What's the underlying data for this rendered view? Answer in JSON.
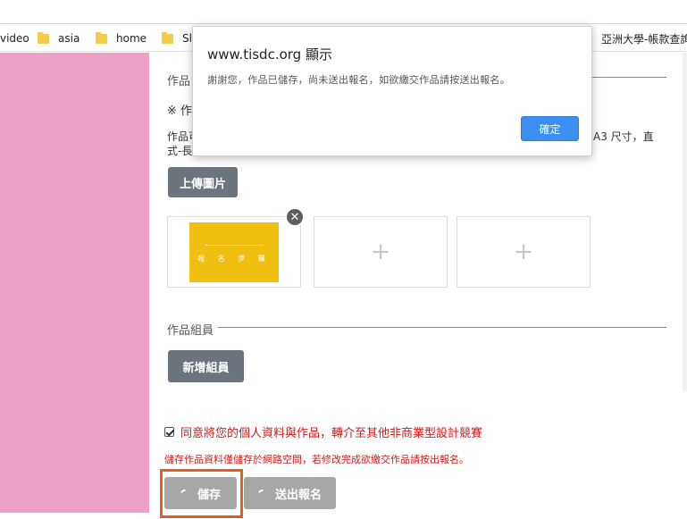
{
  "bookmarks": [
    {
      "label": "video",
      "folder": false
    },
    {
      "label": "asia",
      "folder": true
    },
    {
      "label": "home",
      "folder": true
    },
    {
      "label": "Sl",
      "folder": true
    },
    {
      "label": "亞洲大學-帳款查詢",
      "folder": false
    }
  ],
  "form": {
    "section_works_label": "作品",
    "note_prefix": "※ 作",
    "desc_line1_start": "作品可",
    "desc_line1_end": "A3 尺寸，直",
    "desc_line2_start": "式-長",
    "upload_button": "上傳圖片",
    "thumbnail_text": "報 名 步 驟",
    "members_label": "作品組員",
    "add_member_button": "新增組員",
    "consent_checked": true,
    "consent_text": "同意將您的個人資料與作品，轉介至其他非商業型設計競賽",
    "save_note": "儲存作品資料僅儲存於網路空間，若修改完成欲繳交作品請按出報名。",
    "save_button": "儲存",
    "submit_button": "送出報名"
  },
  "dialog": {
    "title": "www.tisdc.org 顯示",
    "message": "謝謝您，作品已儲存，尚未送出報名，如欲繳交作品請按送出報名。",
    "ok_button": "確定"
  },
  "colors": {
    "side_panel": "#eea1c8",
    "highlight": "#e0601c",
    "error_text": "#d21a1a",
    "primary": "#3b8ff0",
    "thumb": "#f0bf10"
  }
}
